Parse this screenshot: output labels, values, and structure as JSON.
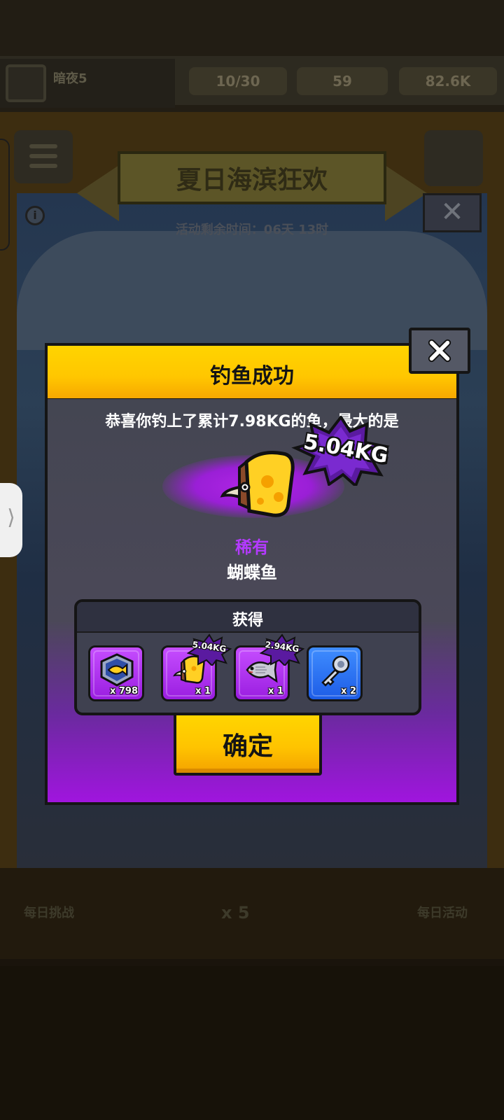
{
  "background": {
    "player_name": "暗夜5",
    "resources": [
      "10/30",
      "59",
      "82.6K"
    ],
    "event_title": "夏日海滨狂欢",
    "event_timer": "活动剩余时间：06天 13时",
    "bottom_left_label": "每日挑战",
    "bottom_center_label": "x 5",
    "bottom_right_label": "每日活动"
  },
  "dialog": {
    "title": "钓鱼成功",
    "message": "恭喜你钓上了累计7.98KG的鱼，最大的是",
    "biggest_weight": "5.04KG",
    "rarity": "稀有",
    "fish_name": "蝴蝶鱼",
    "rewards_title": "获得",
    "rewards": [
      {
        "icon": "fish-token-icon",
        "qty": "x 798",
        "badge": ""
      },
      {
        "icon": "butterfly-fish-icon",
        "qty": "x 1",
        "badge": "5.04KG"
      },
      {
        "icon": "silver-fish-icon",
        "qty": "x 1",
        "badge": "2.94KG"
      },
      {
        "icon": "key-icon",
        "qty": "x 2",
        "badge": ""
      }
    ],
    "confirm_label": "确定"
  },
  "colors": {
    "header_yellow": "#ffc600",
    "rarity_purple": "#b43aff",
    "panel_gray": "#444652",
    "purple_gradient_end": "#a015de",
    "item_blue": "#1d5ce6"
  }
}
